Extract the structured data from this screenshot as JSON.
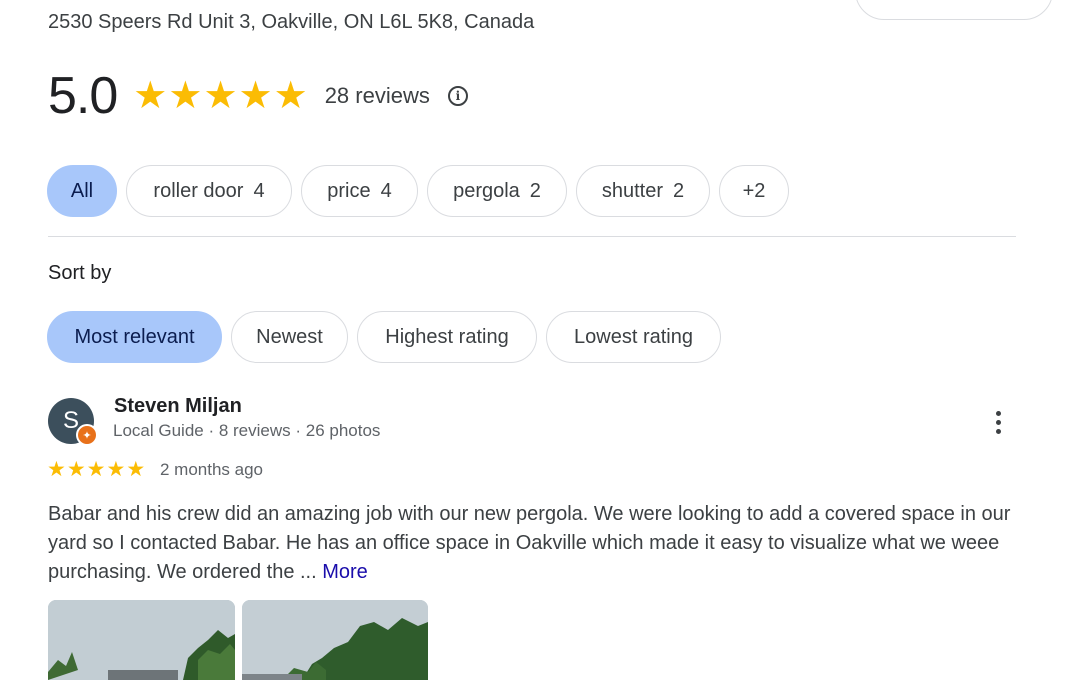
{
  "place": {
    "address": "2530 Speers Rd Unit 3, Oakville, ON L6L 5K8, Canada",
    "rating": "5.0",
    "rating_value": 5,
    "review_count": "28 reviews"
  },
  "topics": [
    {
      "label": "All",
      "count": "",
      "active": true
    },
    {
      "label": "roller door",
      "count": "4",
      "active": false
    },
    {
      "label": "price",
      "count": "4",
      "active": false
    },
    {
      "label": "pergola",
      "count": "2",
      "active": false
    },
    {
      "label": "shutter",
      "count": "2",
      "active": false
    },
    {
      "label": "+2",
      "count": "",
      "active": false
    }
  ],
  "sort": {
    "label": "Sort by",
    "options": [
      {
        "label": "Most relevant",
        "active": true
      },
      {
        "label": "Newest",
        "active": false
      },
      {
        "label": "Highest rating",
        "active": false
      },
      {
        "label": "Lowest rating",
        "active": false
      }
    ]
  },
  "review": {
    "avatar_letter": "S",
    "name": "Steven Miljan",
    "meta": "Local Guide · 8 reviews · 26 photos",
    "rating_value": 5,
    "date": "2 months ago",
    "text": "Babar and his crew did an amazing job with our new pergola. We were looking to add a covered space in our yard so I contacted Babar. He has an office space in Oakville which made it easy to visualize what we weee purchasing. We ordered the ... ",
    "more_label": "More",
    "photos": [
      "photo-1",
      "photo-2"
    ]
  },
  "colors": {
    "accent_chip": "#a8c7fa",
    "star": "#fbbc04",
    "link": "#1a0dab",
    "guide_badge": "#e8711a"
  },
  "icons": {
    "info": "info-icon",
    "more": "more-vert-icon",
    "star": "star-icon",
    "guide": "local-guide-badge-icon"
  }
}
